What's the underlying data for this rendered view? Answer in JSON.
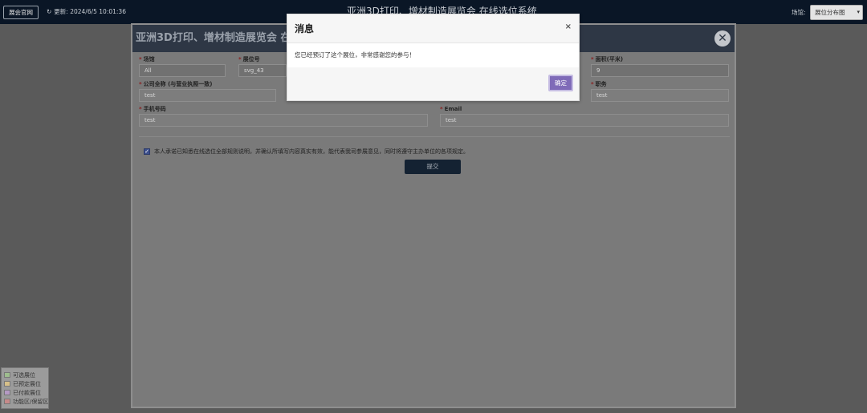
{
  "topbar": {
    "home_button": "展会官网",
    "refresh_icon": "refresh-icon",
    "refresh_text": "更新: 2024/6/5 10:01:36",
    "title": "亚洲3D打印、增材制造展览会 在线选位系统",
    "venue_label": "场馆:",
    "venue_selected": "展位分布图"
  },
  "legend": {
    "items": [
      {
        "label": "可选展位",
        "color": "#9ebd8e"
      },
      {
        "label": "已预定展位",
        "color": "#d7c089"
      },
      {
        "label": "已付款展位",
        "color": "#b59ac4"
      },
      {
        "label": "功能区/保留区",
        "color": "#c78a8a"
      }
    ]
  },
  "form": {
    "title": "亚洲3D打印、增材制造展览会 在",
    "close_icon": "close-circle-icon",
    "fields": {
      "venue": {
        "label": "场馆",
        "value": "All"
      },
      "booth_no": {
        "label": "展位号",
        "value": "svg_43"
      },
      "area": {
        "label": "面积(平米)",
        "value": "9"
      },
      "company": {
        "label": "公司全称 (与营业执照一致)",
        "value": "test"
      },
      "position": {
        "label": "职务",
        "value": "test"
      },
      "phone": {
        "label": "手机号码",
        "value": "test"
      },
      "email": {
        "label": "Email",
        "value": "test"
      }
    },
    "required_mark": "*",
    "agreement": "本人承诺已知悉在线选位全部规则说明，并确认所填写内容真实有效，能代表我司参展意见，同时将遵守主办单位的各项规定。",
    "submit_label": "提交"
  },
  "dialog": {
    "title": "消息",
    "close_glyph": "×",
    "message": "您已经预订了这个展位，非常感谢您的参与！",
    "ok_label": "确定"
  }
}
